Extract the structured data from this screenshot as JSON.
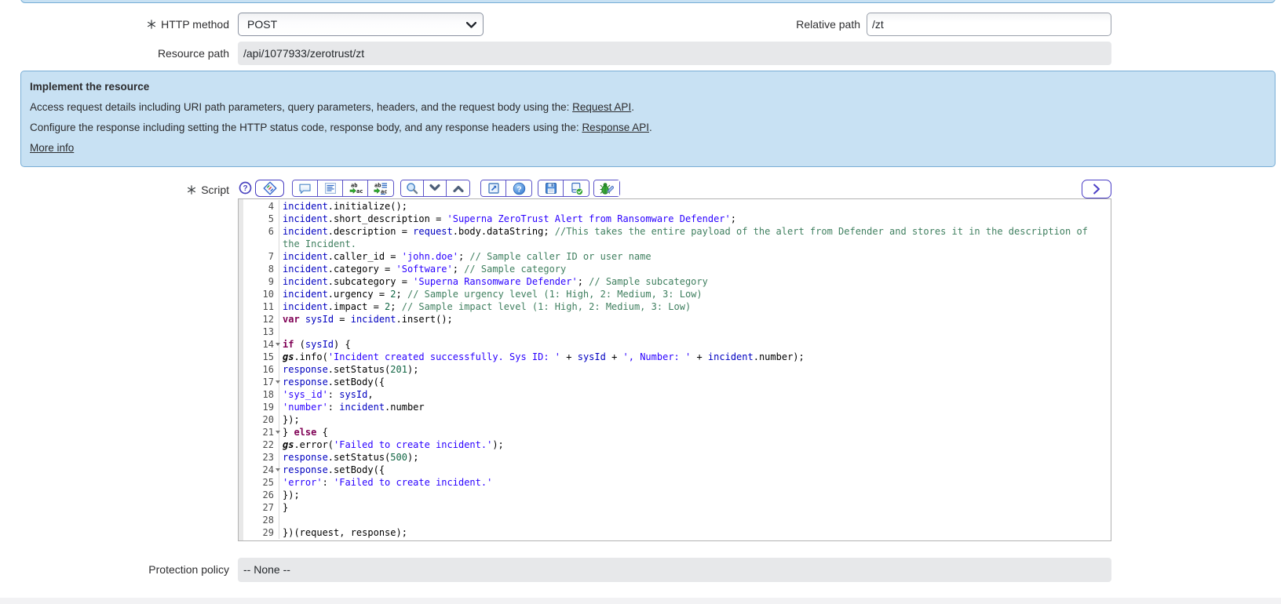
{
  "form": {
    "http_method": {
      "label": "HTTP method",
      "mandatory": true,
      "value": "POST"
    },
    "relative_path": {
      "label": "Relative path",
      "value": "/zt"
    },
    "resource_path": {
      "label": "Resource path",
      "value": "/api/1077933/zerotrust/zt",
      "readonly": true
    },
    "script": {
      "label": "Script",
      "mandatory": true
    },
    "protection_policy": {
      "label": "Protection policy",
      "value": "-- None --",
      "readonly": true
    }
  },
  "info_box": {
    "title": "Implement the resource",
    "lines": [
      {
        "text": "Access request details including URI path parameters, query parameters, headers, and the request body using the: ",
        "link": "Request API",
        "suffix": "."
      },
      {
        "text": "Configure the response including setting the HTTP status code, response body, and any response headers using the: ",
        "link": "Response API",
        "suffix": "."
      }
    ],
    "more_info": "More info",
    "background": "#c8e1f3",
    "border_color": "#79aed6"
  },
  "toolbar": {
    "border_color": "#5a52c8",
    "icons": [
      "script-field-help-icon",
      "syntax-editor-toggle-icon",
      "toggle-comment-icon",
      "format-code-icon",
      "replace-icon",
      "replace-all-icon",
      "search-icon",
      "find-next-icon",
      "find-previous-icon",
      "open-in-window-icon",
      "editor-help-icon",
      "save-icon",
      "syntax-check-icon",
      "debug-icon",
      "expand-editor-icon"
    ]
  },
  "editor": {
    "font_size_px": 12,
    "line_height_px": 16,
    "first_visible_line": 4,
    "token_colors": {
      "p": "#000000",
      "v": "#0000C0",
      "s": "#2A00FF",
      "k": "#7F0055",
      "c": "#3F7F5F",
      "n": "#116644",
      "g": "#000000"
    },
    "lines": [
      {
        "n": 4,
        "fold": false,
        "t": [
          [
            "v",
            "incident"
          ],
          [
            "p",
            ".initialize();"
          ]
        ]
      },
      {
        "n": 5,
        "fold": false,
        "t": [
          [
            "v",
            "incident"
          ],
          [
            "p",
            ".short_description = "
          ],
          [
            "s",
            "'Superna ZeroTrust Alert from Ransomware Defender'"
          ],
          [
            "p",
            ";"
          ]
        ]
      },
      {
        "n": 6,
        "fold": false,
        "t": [
          [
            "v",
            "incident"
          ],
          [
            "p",
            ".description = "
          ],
          [
            "v",
            "request"
          ],
          [
            "p",
            ".body.dataString; "
          ],
          [
            "c",
            "//This takes the entire payload of the alert from Defender and stores it in the description of the Incident."
          ]
        ]
      },
      {
        "n": 7,
        "fold": false,
        "t": [
          [
            "v",
            "incident"
          ],
          [
            "p",
            ".caller_id = "
          ],
          [
            "s",
            "'john.doe'"
          ],
          [
            "p",
            "; "
          ],
          [
            "c",
            "// Sample caller ID or user name"
          ]
        ]
      },
      {
        "n": 8,
        "fold": false,
        "t": [
          [
            "v",
            "incident"
          ],
          [
            "p",
            ".category = "
          ],
          [
            "s",
            "'Software'"
          ],
          [
            "p",
            "; "
          ],
          [
            "c",
            "// Sample category"
          ]
        ]
      },
      {
        "n": 9,
        "fold": false,
        "t": [
          [
            "v",
            "incident"
          ],
          [
            "p",
            ".subcategory = "
          ],
          [
            "s",
            "'Superna Ransomware Defender'"
          ],
          [
            "p",
            "; "
          ],
          [
            "c",
            "// Sample subcategory"
          ]
        ]
      },
      {
        "n": 10,
        "fold": false,
        "t": [
          [
            "v",
            "incident"
          ],
          [
            "p",
            ".urgency = "
          ],
          [
            "n",
            "2"
          ],
          [
            "p",
            "; "
          ],
          [
            "c",
            "// Sample urgency level (1: High, 2: Medium, 3: Low)"
          ]
        ]
      },
      {
        "n": 11,
        "fold": false,
        "t": [
          [
            "v",
            "incident"
          ],
          [
            "p",
            ".impact = "
          ],
          [
            "n",
            "2"
          ],
          [
            "p",
            "; "
          ],
          [
            "c",
            "// Sample impact level (1: High, 2: Medium, 3: Low)"
          ]
        ]
      },
      {
        "n": 12,
        "fold": false,
        "t": [
          [
            "k",
            "var"
          ],
          [
            "p",
            " "
          ],
          [
            "v",
            "sysId"
          ],
          [
            "p",
            " = "
          ],
          [
            "v",
            "incident"
          ],
          [
            "p",
            ".insert();"
          ]
        ]
      },
      {
        "n": 13,
        "fold": false,
        "t": []
      },
      {
        "n": 14,
        "fold": true,
        "t": [
          [
            "k",
            "if"
          ],
          [
            "p",
            " ("
          ],
          [
            "v",
            "sysId"
          ],
          [
            "p",
            ") {"
          ]
        ]
      },
      {
        "n": 15,
        "fold": false,
        "t": [
          [
            "g",
            "gs"
          ],
          [
            "p",
            ".info("
          ],
          [
            "s",
            "'Incident created successfully. Sys ID: '"
          ],
          [
            "p",
            " + "
          ],
          [
            "v",
            "sysId"
          ],
          [
            "p",
            " + "
          ],
          [
            "s",
            "', Number: '"
          ],
          [
            "p",
            " + "
          ],
          [
            "v",
            "incident"
          ],
          [
            "p",
            ".number);"
          ]
        ]
      },
      {
        "n": 16,
        "fold": false,
        "t": [
          [
            "v",
            "response"
          ],
          [
            "p",
            ".setStatus("
          ],
          [
            "n",
            "201"
          ],
          [
            "p",
            ");"
          ]
        ]
      },
      {
        "n": 17,
        "fold": true,
        "t": [
          [
            "v",
            "response"
          ],
          [
            "p",
            ".setBody({"
          ]
        ]
      },
      {
        "n": 18,
        "fold": false,
        "t": [
          [
            "s",
            "'sys_id'"
          ],
          [
            "p",
            ": "
          ],
          [
            "v",
            "sysId"
          ],
          [
            "p",
            ","
          ]
        ]
      },
      {
        "n": 19,
        "fold": false,
        "t": [
          [
            "s",
            "'number'"
          ],
          [
            "p",
            ": "
          ],
          [
            "v",
            "incident"
          ],
          [
            "p",
            ".number"
          ]
        ]
      },
      {
        "n": 20,
        "fold": false,
        "t": [
          [
            "p",
            "});"
          ]
        ]
      },
      {
        "n": 21,
        "fold": true,
        "t": [
          [
            "p",
            "} "
          ],
          [
            "k",
            "else"
          ],
          [
            "p",
            " {"
          ]
        ]
      },
      {
        "n": 22,
        "fold": false,
        "t": [
          [
            "g",
            "gs"
          ],
          [
            "p",
            ".error("
          ],
          [
            "s",
            "'Failed to create incident.'"
          ],
          [
            "p",
            ");"
          ]
        ]
      },
      {
        "n": 23,
        "fold": false,
        "t": [
          [
            "v",
            "response"
          ],
          [
            "p",
            ".setStatus("
          ],
          [
            "n",
            "500"
          ],
          [
            "p",
            ");"
          ]
        ]
      },
      {
        "n": 24,
        "fold": true,
        "t": [
          [
            "v",
            "response"
          ],
          [
            "p",
            ".setBody({"
          ]
        ]
      },
      {
        "n": 25,
        "fold": false,
        "t": [
          [
            "s",
            "'error'"
          ],
          [
            "p",
            ": "
          ],
          [
            "s",
            "'Failed to create incident.'"
          ]
        ]
      },
      {
        "n": 26,
        "fold": false,
        "t": [
          [
            "p",
            "});"
          ]
        ]
      },
      {
        "n": 27,
        "fold": false,
        "t": [
          [
            "p",
            "}"
          ]
        ]
      },
      {
        "n": 28,
        "fold": false,
        "t": []
      },
      {
        "n": 29,
        "fold": false,
        "t": [
          [
            "p",
            "})(request, response);"
          ]
        ]
      }
    ]
  }
}
